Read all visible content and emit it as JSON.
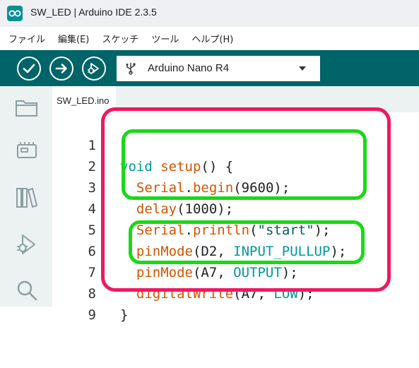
{
  "window": {
    "title": "SW_LED | Arduino IDE 2.3.5"
  },
  "menu": {
    "items": [
      "ファイル",
      "編集(E)",
      "スケッチ",
      "ツール",
      "ヘルプ(H)"
    ]
  },
  "toolbar": {
    "verify_icon": "check-icon",
    "upload_icon": "arrow-right-icon",
    "debug_icon": "debugger-icon",
    "board": "Arduino Nano R4"
  },
  "sidebar": {
    "items": [
      "folder-icon",
      "board-icon",
      "library-icon",
      "debug-icon",
      "search-icon"
    ]
  },
  "tabs": [
    {
      "label": "SW_LED.ino"
    }
  ],
  "editor": {
    "lines": [
      {
        "number": "1",
        "text": "void setup() {"
      },
      {
        "number": "2",
        "text": "  Serial.begin(9600);"
      },
      {
        "number": "3",
        "text": "  delay(1000);"
      },
      {
        "number": "4",
        "text": "  Serial.println(\"start\");"
      },
      {
        "number": "5",
        "text": "  pinMode(D2, INPUT_PULLUP);"
      },
      {
        "number": "6",
        "text": "  pinMode(A7, OUTPUT);"
      },
      {
        "number": "7",
        "text": "  digitalWrite(A7, LOW);"
      },
      {
        "number": "8",
        "text": "}"
      },
      {
        "number": "9",
        "text": ""
      }
    ]
  },
  "colors": {
    "toolbar": "#006468",
    "keyword": "#00979c",
    "function": "#d35400",
    "annotation_outer": "#ef1863",
    "annotation_inner": "#19d916"
  }
}
